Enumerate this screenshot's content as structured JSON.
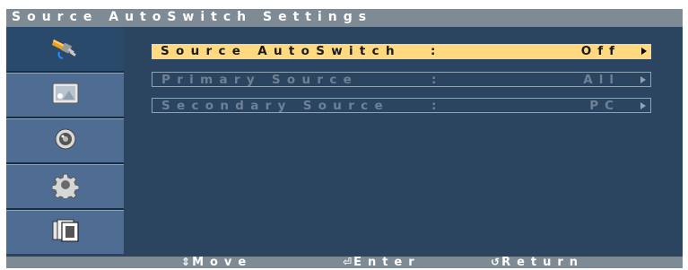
{
  "header": {
    "title": "Source AutoSwitch Settings"
  },
  "sidebar": {
    "items": [
      {
        "icon": "input-plug-icon"
      },
      {
        "icon": "picture-icon"
      },
      {
        "icon": "sound-speaker-icon"
      },
      {
        "icon": "setup-gear-icon"
      },
      {
        "icon": "multi-screen-icon"
      }
    ]
  },
  "menu": {
    "rows": [
      {
        "label": "Source AutoSwitch",
        "value": "Off"
      },
      {
        "label": "Primary Source",
        "value": "All"
      },
      {
        "label": "Secondary Source",
        "value": "PC"
      }
    ],
    "separator": ":"
  },
  "footer": {
    "move_icon": "⇕",
    "move_label": "Move",
    "enter_icon": "⏎",
    "enter_label": "Enter",
    "return_icon": "↺",
    "return_label": "Return"
  },
  "colors": {
    "title_bar": "#7e8b94",
    "panel": "#2b4560",
    "selected_row": "#ffd980",
    "disabled_text": "#6e8196"
  }
}
